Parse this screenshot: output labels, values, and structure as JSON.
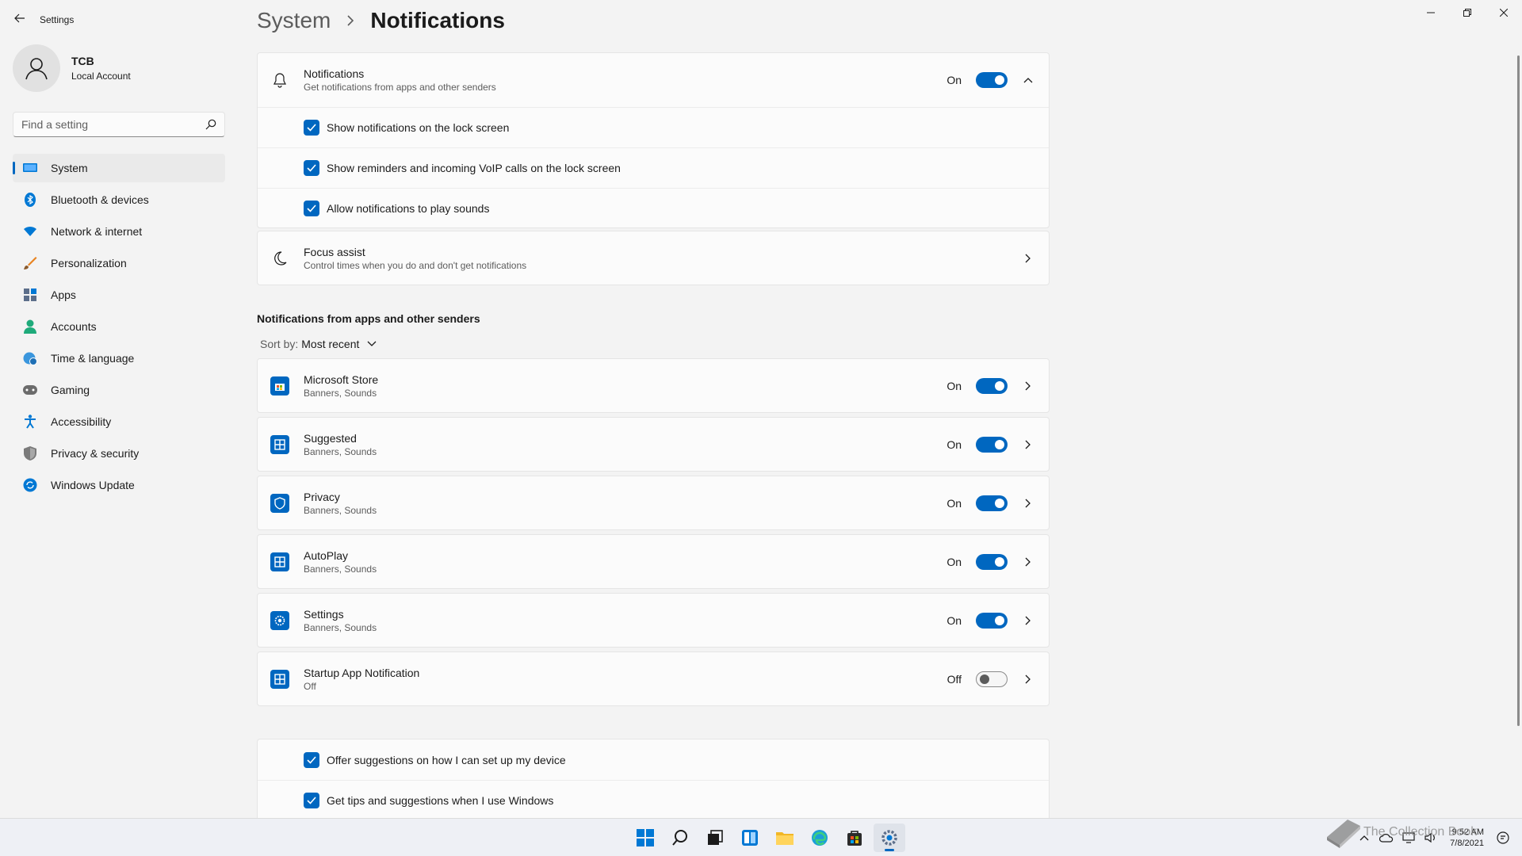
{
  "window": {
    "title": "Settings"
  },
  "profile": {
    "name": "TCB",
    "account_type": "Local Account"
  },
  "search": {
    "placeholder": "Find a setting"
  },
  "nav": {
    "items": [
      {
        "label": "System",
        "icon": "monitor-icon",
        "active": true
      },
      {
        "label": "Bluetooth & devices",
        "icon": "bluetooth-icon"
      },
      {
        "label": "Network & internet",
        "icon": "wifi-icon"
      },
      {
        "label": "Personalization",
        "icon": "brush-icon"
      },
      {
        "label": "Apps",
        "icon": "apps-icon"
      },
      {
        "label": "Accounts",
        "icon": "person-icon"
      },
      {
        "label": "Time & language",
        "icon": "globe-clock-icon"
      },
      {
        "label": "Gaming",
        "icon": "gamepad-icon"
      },
      {
        "label": "Accessibility",
        "icon": "accessibility-icon"
      },
      {
        "label": "Privacy & security",
        "icon": "shield-icon"
      },
      {
        "label": "Windows Update",
        "icon": "update-icon"
      }
    ]
  },
  "breadcrumb": {
    "parent": "System",
    "separator": "›",
    "current": "Notifications"
  },
  "notifications": {
    "title": "Notifications",
    "subtitle": "Get notifications from apps and other senders",
    "state": "On",
    "options": [
      {
        "label": "Show notifications on the lock screen",
        "checked": true
      },
      {
        "label": "Show reminders and incoming VoIP calls on the lock screen",
        "checked": true
      },
      {
        "label": "Allow notifications to play sounds",
        "checked": true
      }
    ]
  },
  "focus_assist": {
    "title": "Focus assist",
    "subtitle": "Control times when you do and don't get notifications"
  },
  "senders": {
    "section_title": "Notifications from apps and other senders",
    "sort_label": "Sort by:",
    "sort_value": "Most recent",
    "apps": [
      {
        "name": "Microsoft Store",
        "detail": "Banners, Sounds",
        "state": "On",
        "on": true,
        "icon": "store-icon"
      },
      {
        "name": "Suggested",
        "detail": "Banners, Sounds",
        "state": "On",
        "on": true,
        "icon": "suggested-icon"
      },
      {
        "name": "Privacy",
        "detail": "Banners, Sounds",
        "state": "On",
        "on": true,
        "icon": "privacy-shield-icon"
      },
      {
        "name": "AutoPlay",
        "detail": "Banners, Sounds",
        "state": "On",
        "on": true,
        "icon": "autoplay-icon"
      },
      {
        "name": "Settings",
        "detail": "Banners, Sounds",
        "state": "On",
        "on": true,
        "icon": "settings-gear-icon"
      },
      {
        "name": "Startup App Notification",
        "detail": "Off",
        "state": "Off",
        "on": false,
        "icon": "startup-app-icon"
      }
    ]
  },
  "tips": {
    "options": [
      {
        "label": "Offer suggestions on how I can set up my device",
        "checked": true
      },
      {
        "label": "Get tips and suggestions when I use Windows",
        "checked": true
      }
    ]
  },
  "taskbar": {
    "icons": [
      "start-icon",
      "search-icon",
      "task-view-icon",
      "widgets-icon",
      "file-explorer-icon",
      "edge-icon",
      "store-icon",
      "settings-icon"
    ],
    "time": "9:52 AM",
    "date": "7/8/2021"
  },
  "watermark": {
    "text": "The Collection Book"
  },
  "colors": {
    "accent": "#0067c0",
    "background": "#f3f3f3",
    "card": "#fbfbfb"
  }
}
